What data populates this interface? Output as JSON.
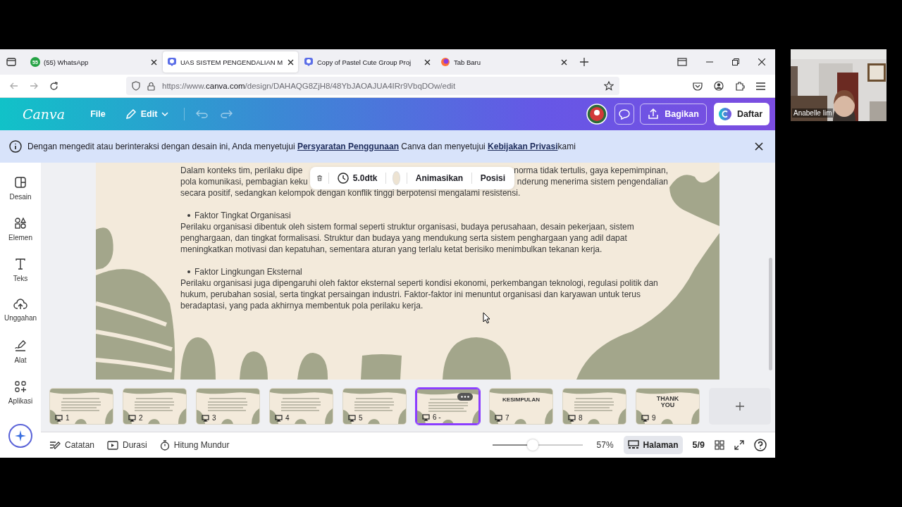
{
  "browser": {
    "tabs": [
      {
        "label": "(55) WhatsApp",
        "kind": "whatsapp",
        "selected": false
      },
      {
        "label": "UAS SISTEM PENGENDALIAN M",
        "kind": "canva",
        "selected": true
      },
      {
        "label": "Copy of Pastel Cute Group Proj",
        "kind": "canva",
        "selected": false
      },
      {
        "label": "Tab Baru",
        "kind": "firefox",
        "selected": false
      }
    ],
    "badge": "55",
    "url": "https://www.**canva.com**/design/DAHAQG8ZjH8/48YbJAOAJUA4IRr9VbqDOw/edit"
  },
  "header": {
    "logo": "Canva",
    "menus": [
      "File",
      "Edit"
    ],
    "share": "Bagikan",
    "signup": "Daftar"
  },
  "notice": {
    "parts": [
      {
        "kind": "text",
        "text": "Dengan mengedit atau berinteraksi dengan desain ini, Anda menyetujui "
      },
      {
        "kind": "link",
        "text": "Persyaratan Penggunaan"
      },
      {
        "kind": "text",
        "text": " Canva dan menyetujui "
      },
      {
        "kind": "link",
        "text": "Kebijakan Privasi"
      },
      {
        "kind": "text",
        "text": "kami"
      }
    ]
  },
  "sidebar": {
    "items": [
      {
        "label": "Desain",
        "kind": "layout"
      },
      {
        "label": "Elemen",
        "kind": "shapes"
      },
      {
        "label": "Teks",
        "kind": "text"
      },
      {
        "label": "Unggahan",
        "kind": "upload"
      },
      {
        "label": "Alat",
        "kind": "pen"
      },
      {
        "label": "Aplikasi",
        "kind": "apps"
      }
    ]
  },
  "slide": {
    "split_lines": [
      {
        "left": "Dalam konteks tim, perilaku dipe",
        "right": "norma tidak tertulis, gaya kepemimpinan,"
      },
      {
        "left": "pola komunikasi, pembagian keku",
        "right": "nderung menerima sistem pengendalian"
      }
    ],
    "blocks": [
      {
        "kind": "text",
        "text": "secara positif, sedangkan kelompok dengan konflik tinggi berpotensi mengalami resistensi."
      },
      {
        "kind": "bullet",
        "text": "Faktor Tingkat Organisasi"
      },
      {
        "kind": "text",
        "text": " Perilaku organisasi dibentuk oleh sistem formal seperti struktur organisasi, budaya perusahaan, desain pekerjaan, sistem penghargaan, dan tingkat formalisasi. Struktur dan budaya yang mendukung serta sistem penghargaan yang adil dapat meningkatkan motivasi dan kepatuhan, sementara aturan yang terlalu ketat berisiko menimbulkan tekanan kerja."
      },
      {
        "kind": "bullet",
        "text": "Faktor Lingkungan Eksternal"
      },
      {
        "kind": "text",
        "text": "Perilaku organisasi juga dipengaruhi oleh faktor eksternal seperti kondisi ekonomi, perkembangan teknologi, regulasi politik dan hukum, perubahan sosial, serta tingkat persaingan industri. Faktor-faktor ini menuntut organisasi dan karyawan untuk terus beradaptasi, yang pada akhirnya membentuk pola perilaku kerja."
      }
    ]
  },
  "toolbar": {
    "duration": "5.0dtk",
    "color": "#ede3d2",
    "animate": "Animasikan",
    "position": "Posisi"
  },
  "pages": [
    {
      "number": "1",
      "selected": false
    },
    {
      "number": "2",
      "selected": false
    },
    {
      "number": "3",
      "selected": false
    },
    {
      "number": "4",
      "selected": false
    },
    {
      "number": "5",
      "selected": false
    },
    {
      "number": "6 -",
      "selected": true
    },
    {
      "number": "7",
      "title": "KESIMPULAN",
      "selected": false
    },
    {
      "number": "8",
      "selected": false
    },
    {
      "number": "9",
      "title": "THANK YOU",
      "selected": false
    }
  ],
  "footer": {
    "notes": "Catatan",
    "duration": "Durasi",
    "timer": "Hitung Mundur",
    "zoom": {
      "level": 0.45,
      "reading": "57%"
    },
    "pages_view": {
      "label": "Halaman",
      "selected": true
    },
    "page_count": "5/9"
  },
  "webcam": {
    "name": "Anabelle lim"
  }
}
